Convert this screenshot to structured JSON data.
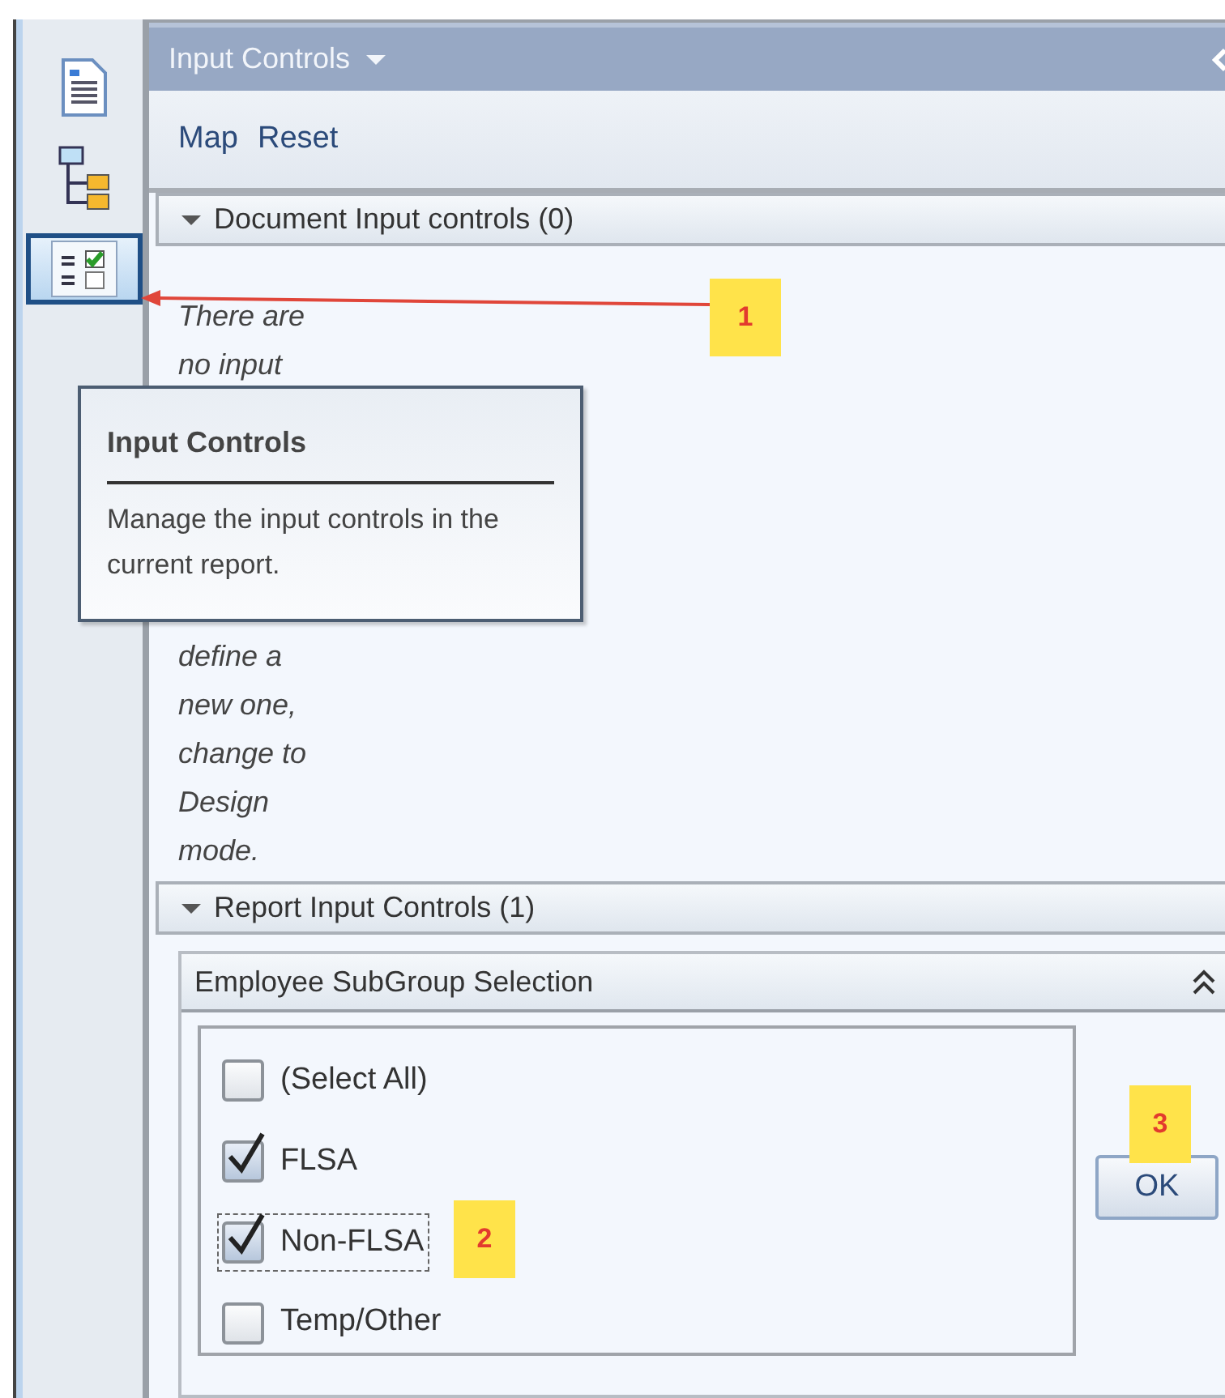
{
  "sidebar": {
    "items": [
      {
        "selected": false
      },
      {
        "selected": false
      },
      {
        "selected": true
      }
    ]
  },
  "panel": {
    "title": "Input Controls",
    "toolbar": [
      "Map",
      "Reset"
    ],
    "sections": [
      {
        "kind": "note",
        "title": "Document Input controls (0)",
        "expanded": true,
        "lines": [
          "There are",
          "no input",
          "define a",
          "new one,",
          "change to",
          "Design",
          "mode."
        ]
      },
      {
        "kind": "controls",
        "title": "Report Input Controls (1)",
        "expanded": true,
        "group": {
          "title": "Employee SubGroup Selection",
          "items": [
            {
              "label": "(Select All)",
              "checked": false,
              "focused": false
            },
            {
              "label": "FLSA",
              "checked": true,
              "focused": false
            },
            {
              "label": "Non-FLSA",
              "checked": true,
              "focused": true
            },
            {
              "label": "Temp/Other",
              "checked": false,
              "focused": false
            }
          ],
          "button": "OK"
        }
      }
    ]
  },
  "tooltip": {
    "title": "Input Controls",
    "text": "Manage the input controls in the current report."
  },
  "annotations": [
    "1",
    "2",
    "3"
  ]
}
